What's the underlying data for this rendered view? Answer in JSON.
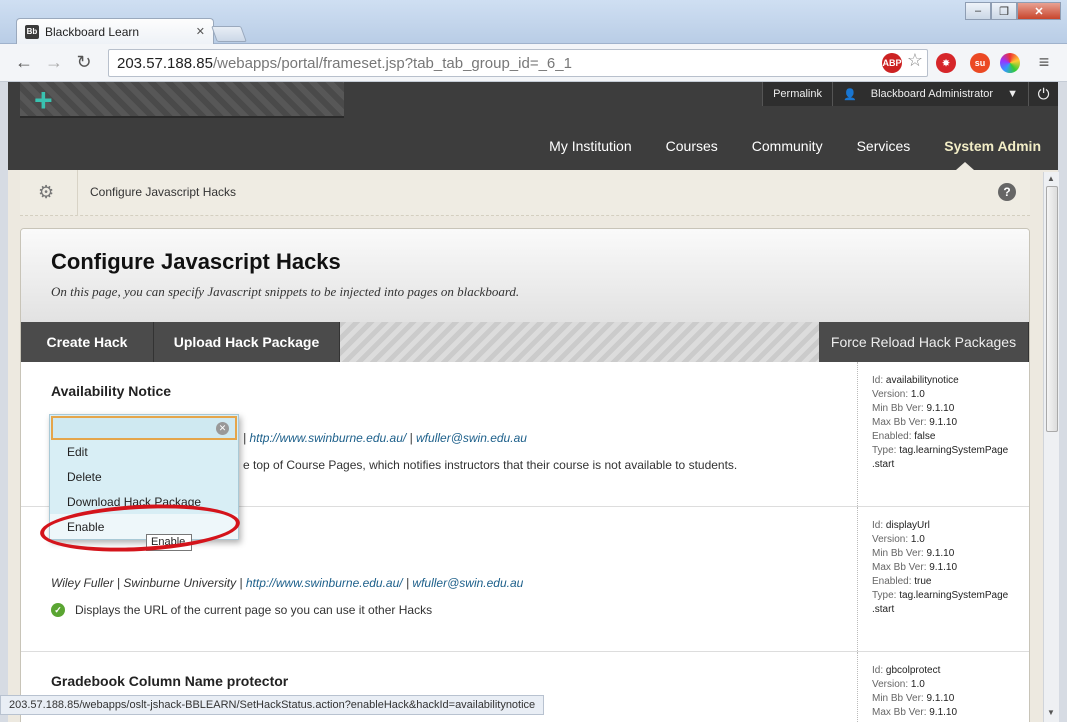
{
  "browser": {
    "tab_title": "Blackboard Learn",
    "tab_favicon": "Bb",
    "url_host": "203.57.188.85",
    "url_path": "/webapps/portal/frameset.jsp?tab_tab_group_id=_6_1",
    "status_url": "203.57.188.85/webapps/oslt-jshack-BBLEARN/SetHackStatus.action?enableHack&hackId=availabilitynotice",
    "icons": [
      "back-icon",
      "forward-icon",
      "reload-icon",
      "adblock-icon",
      "star-icon",
      "extension-icon",
      "stumbleupon-icon",
      "color-wheel-icon",
      "menu-icon"
    ]
  },
  "header": {
    "permalink": "Permalink",
    "user": "Blackboard Administrator",
    "nav": [
      "My Institution",
      "Courses",
      "Community",
      "Services",
      "System Admin"
    ],
    "active_nav": "System Admin"
  },
  "breadcrumb": {
    "title": "Configure Javascript Hacks"
  },
  "page": {
    "title": "Configure Javascript Hacks",
    "subtitle": "On this page, you can specify Javascript snippets to be injected into pages on blackboard."
  },
  "actions": {
    "create": "Create Hack",
    "upload": "Upload Hack Package",
    "reload": "Force Reload Hack Packages"
  },
  "hacks": [
    {
      "title": "Availability Notice",
      "author_sep": " | ",
      "author_link1": "http://www.swinburne.edu.au/",
      "author_link2": "wfuller@swin.edu.au",
      "desc_fragment": "e top of Course Pages, which notifies instructors that their course is not available to students.",
      "meta": {
        "id": "availabilitynotice",
        "version": "1.0",
        "min": "9.1.10",
        "max": "9.1.10",
        "enabled": "false",
        "type": "tag.learningSystemPage",
        "type2": ".start"
      }
    },
    {
      "author": "Wiley Fuller | Swinburne University",
      "author_sep": " | ",
      "author_link1": "http://www.swinburne.edu.au/",
      "author_link2": "wfuller@swin.edu.au",
      "desc": "Displays the URL of the current page so you can use it other Hacks",
      "meta": {
        "id": "displayUrl",
        "version": "1.0",
        "min": "9.1.10",
        "max": "9.1.10",
        "enabled": "true",
        "type": "tag.learningSystemPage",
        "type2": ".start"
      }
    },
    {
      "title": "Gradebook Column Name protector",
      "meta": {
        "id": "gbcolprotect",
        "version": "1.0",
        "min": "9.1.10",
        "max": "9.1.10"
      }
    }
  ],
  "meta_labels": {
    "id": "Id:",
    "version": "Version:",
    "min": "Min Bb Ver:",
    "max": "Max Bb Ver:",
    "enabled": "Enabled:",
    "type": "Type:"
  },
  "context_menu": {
    "items": [
      "Edit",
      "Delete",
      "Download Hack Package",
      "Enable"
    ],
    "tooltip": "Enable"
  },
  "window": {
    "minimize": "–",
    "restore": "❐",
    "close": "✕"
  }
}
